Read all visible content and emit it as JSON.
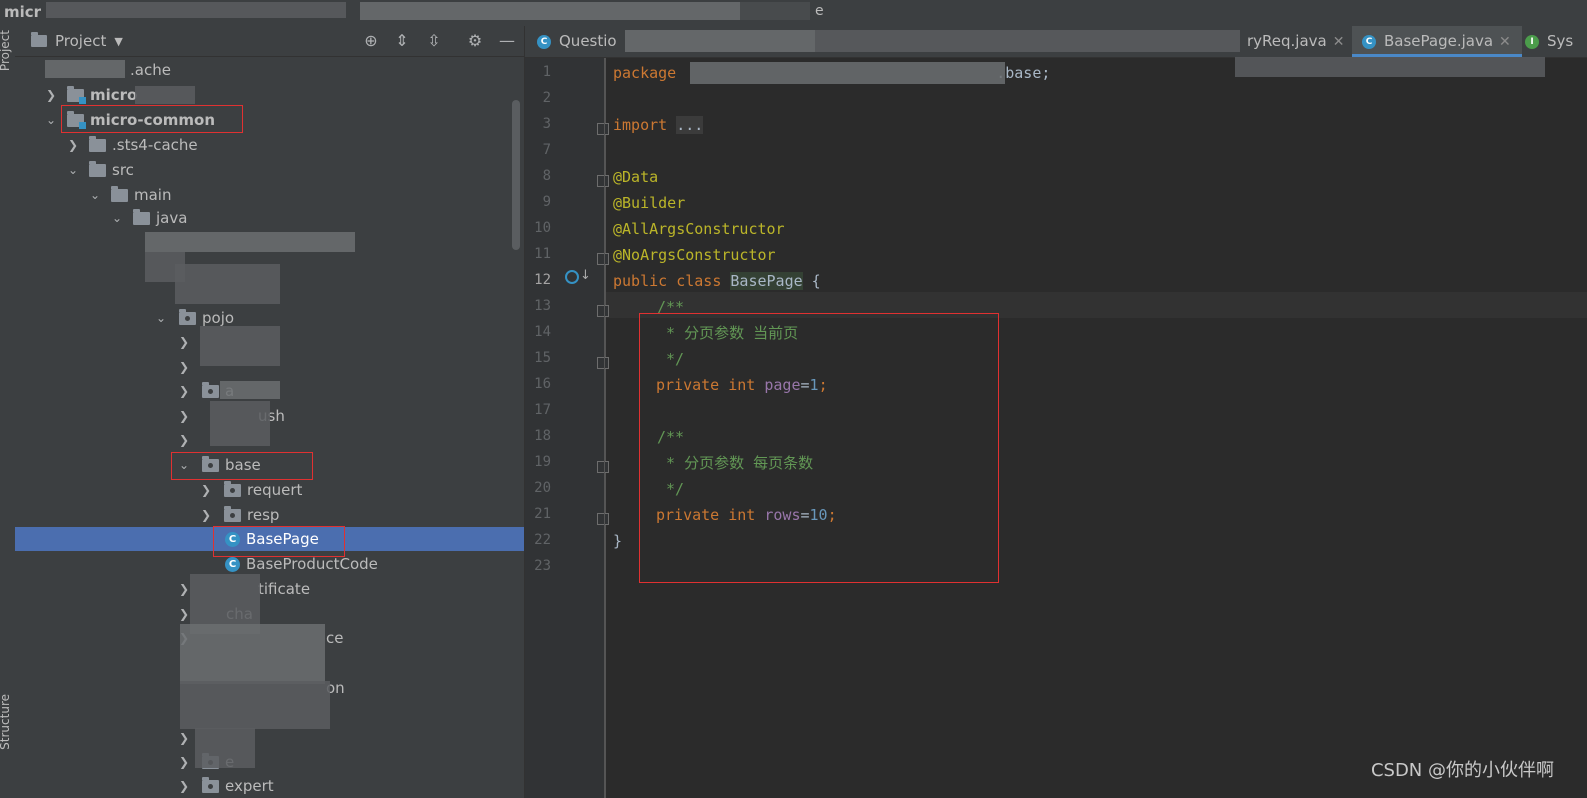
{
  "window": {
    "title": "micr",
    "title_suffix": "e"
  },
  "left_strip": {
    "project_label": "Project",
    "structure_label": "Structure"
  },
  "project_panel": {
    "title": "Project",
    "tree": {
      "r0": ".ache",
      "r1": "micro",
      "r2": "micro-common",
      "r3": ".sts4-cache",
      "r4": "src",
      "r5": "main",
      "r6": "java",
      "r7": "pojo",
      "r8": "a",
      "r9": "ush",
      "r10": "base",
      "r11": "requert",
      "r12": "resp",
      "r13": "BasePage",
      "r14": "BaseProductCode",
      "r15": "tificate",
      "r16": "cha",
      "r17": "ce",
      "r18": "on",
      "r19": "e",
      "r20": "expert"
    }
  },
  "tabs": [
    {
      "label": "Questio"
    },
    {
      "label": "ryReq.java"
    },
    {
      "label": "BasePage.java"
    },
    {
      "label": "Sys"
    }
  ],
  "editor": {
    "line_numbers": [
      "1",
      "2",
      "3",
      "7",
      "8",
      "9",
      "10",
      "11",
      "12",
      "13",
      "14",
      "15",
      "16",
      "17",
      "18",
      "19",
      "20",
      "21",
      "22",
      "23"
    ],
    "code": {
      "l1_kw": "package",
      "l1_rest": ".base;",
      "l3_kw": "import",
      "l3_fold": "...",
      "l8": "@Data",
      "l9": "@Builder",
      "l10": "@AllArgsConstructor",
      "l11": "@NoArgsConstructor",
      "l12_kw": "public class",
      "l12_cls": "BasePage",
      "l12_end": " {",
      "l13": "/**",
      "l14": " * 分页参数 当前页",
      "l15": " */",
      "l16_kw": "private int",
      "l16_fd": "page",
      "l16_eq": "=",
      "l16_num": "1",
      "l16_end": ";",
      "l18": "/**",
      "l19": " * 分页参数 每页条数",
      "l20": " */",
      "l21_kw": "private int",
      "l21_fd": "rows",
      "l21_eq": "=",
      "l21_num": "10",
      "l21_end": ";",
      "l22": "}"
    }
  },
  "watermark": "CSDN @你的小伙伴啊",
  "colors": {
    "selection": "#4b6eaf",
    "annotation_box": "#e03131",
    "keyword": "#cc7832",
    "annotation": "#bbb529",
    "comment": "#629755",
    "field": "#9876aa",
    "number": "#6897bb"
  }
}
